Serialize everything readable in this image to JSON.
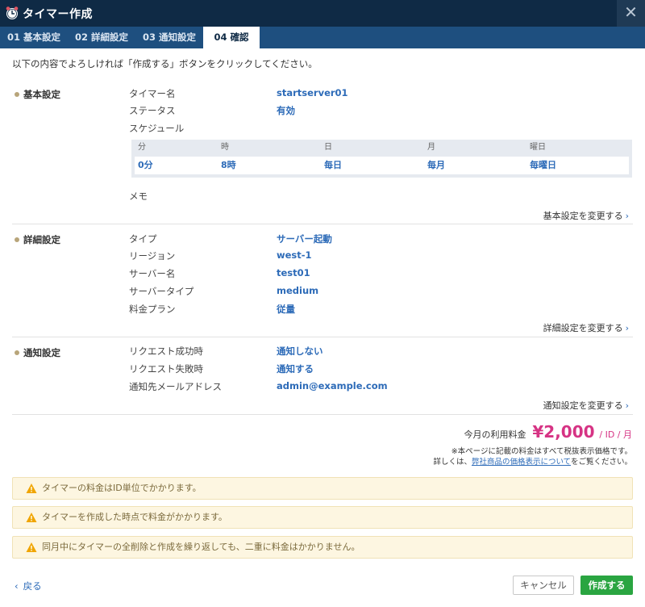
{
  "window": {
    "title": "タイマー作成",
    "close_symbol": "✕"
  },
  "tabs": [
    {
      "label": "01 基本設定"
    },
    {
      "label": "02 詳細設定"
    },
    {
      "label": "03 通知設定"
    },
    {
      "label": "04 確認",
      "active": true
    }
  ],
  "intro": "以下の内容でよろしければ「作成する」ボタンをクリックしてください。",
  "basic": {
    "title": "基本設定",
    "fields": [
      {
        "label": "タイマー名",
        "value": "startserver01"
      },
      {
        "label": "ステータス",
        "value": "有効"
      },
      {
        "label": "スケジュール",
        "value": ""
      }
    ],
    "schedule": {
      "headers": [
        "分",
        "時",
        "日",
        "月",
        "曜日"
      ],
      "values": [
        "0分",
        "8時",
        "毎日",
        "毎月",
        "毎曜日"
      ]
    },
    "memo_label": "メモ",
    "change_link": "基本設定を変更する"
  },
  "detail": {
    "title": "詳細設定",
    "fields": [
      {
        "label": "タイプ",
        "value": "サーバー起動"
      },
      {
        "label": "リージョン",
        "value": "west-1"
      },
      {
        "label": "サーバー名",
        "value": "test01"
      },
      {
        "label": "サーバータイプ",
        "value": "medium"
      },
      {
        "label": "料金プラン",
        "value": "従量"
      }
    ],
    "change_link": "詳細設定を変更する"
  },
  "notify": {
    "title": "通知設定",
    "fields": [
      {
        "label": "リクエスト成功時",
        "value": "通知しない"
      },
      {
        "label": "リクエスト失敗時",
        "value": "通知する"
      },
      {
        "label": "通知先メールアドレス",
        "value": "admin@example.com"
      }
    ],
    "change_link": "通知設定を変更する"
  },
  "price": {
    "label": "今月の利用料金",
    "amount": "¥2,000",
    "unit": "/ ID / 月",
    "note1": "※本ページに記載の料金はすべて税抜表示価格です。",
    "note2_pre": "詳しくは、",
    "note2_link": "弊社商品の価格表示について",
    "note2_post": "をご覧ください。"
  },
  "warnings": [
    "タイマーの料金はID単位でかかります。",
    "タイマーを作成した時点で料金がかかります。",
    "同月中にタイマーの全削除と作成を繰り返しても、二重に料金はかかりません。"
  ],
  "footer": {
    "back": "戻る",
    "cancel": "キャンセル",
    "create": "作成する"
  },
  "colors": {
    "titlebar": "#0f2a45",
    "tabbar": "#1e4f7f",
    "value": "#2d6bb8",
    "price": "#d63384",
    "create": "#2aa541",
    "warning_bg": "#fdf6e1"
  },
  "icons": {
    "title": "alarm-clock-icon",
    "warning": "warning-triangle-icon",
    "close": "close-icon"
  }
}
